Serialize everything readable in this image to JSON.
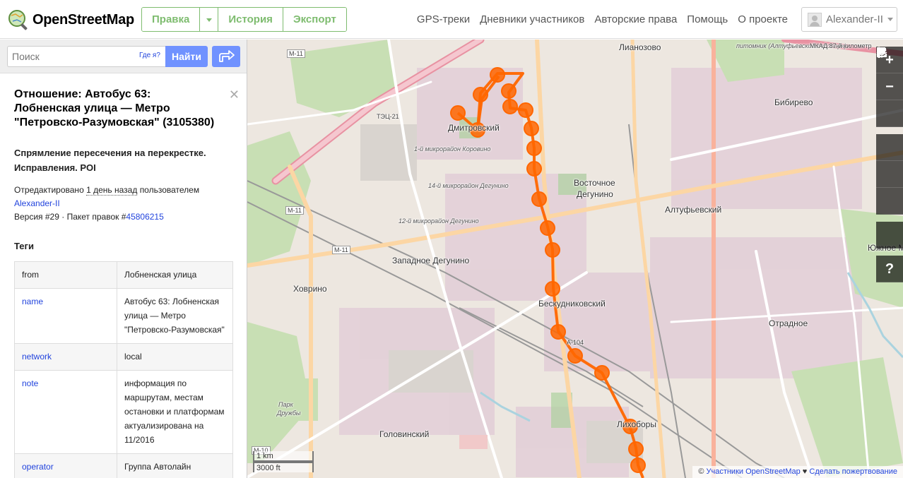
{
  "header": {
    "logo_text": "OpenStreetMap",
    "edit_label": "Правка",
    "history_label": "История",
    "export_label": "Экспорт",
    "nav": [
      "GPS-треки",
      "Дневники участников",
      "Авторские права",
      "Помощь",
      "О проекте"
    ],
    "user_name": "Alexander-II"
  },
  "search": {
    "placeholder": "Поиск",
    "where_label": "Где я?",
    "go_label": "Найти"
  },
  "sidebar": {
    "title": "Отношение: Автобус 63: Лобненская улица — Метро \"Петровско-Разумовская\" (3105380)",
    "comment": "Спрямление пересечения на перекрестке. Исправления. POI",
    "edited_prefix": "Отредактировано",
    "edited_ago": "1 день назад",
    "edited_by": "пользователем",
    "user": "Alexander-II",
    "version_prefix": "Версия #29 · Пакет правок #",
    "changeset": "45806215",
    "tags_title": "Теги",
    "tags": [
      {
        "key": "from",
        "value": "Лобненская улица",
        "link": false
      },
      {
        "key": "name",
        "value": "Автобус 63: Лобненская улица — Метро \"Петровско-Разумовская\"",
        "link": true
      },
      {
        "key": "network",
        "value": "local",
        "link": true
      },
      {
        "key": "note",
        "value": "информация по маршрутам, местам остановки и платформам актуализирована на 11/2016",
        "link": true
      },
      {
        "key": "operator",
        "value": "Группа Автолайн",
        "link": true
      }
    ]
  },
  "map": {
    "labels": {
      "dmitrovsky": "Дмитровский",
      "vostochnoe": "Восточное",
      "degunino": "Дегунино",
      "zapadnoe": "Западное Дегунино",
      "khovrino": "Ховрино",
      "beskudnikovsky": "Бескудниковский",
      "altufevsky": "Алтуфьевский",
      "bibirevo": "Бибирево",
      "lianozovo": "Лианозово",
      "otradnoe": "Отрадное",
      "golovinsky": "Головинский",
      "likhobory": "Лихоборы",
      "yuzhnoe": "Южное М",
      "park": "Парк",
      "druzhby": "Дружбы",
      "tets": "ТЭЦ-21",
      "m11": "М-11",
      "m10": "М-10",
      "a104": "А-104",
      "korovino": "1-й микрорайон Коровино",
      "mkr14": "14-й микрорайон Дегунино",
      "mkr12": "12-й микрорайон Дегунино",
      "pitomnik": "питомник (Алтуфьевский лесопарк)",
      "mkad": "МКАД 87-й километр"
    },
    "scale_km": "1 km",
    "scale_ft": "3000 ft",
    "attribution_prefix": "© ",
    "attribution_link": "Участники OpenStreetMap",
    "attribution_heart": " ♥ ",
    "attribution_donate": "Сделать пожертвование"
  },
  "colors": {
    "accent": "#7ebc6f",
    "search_button": "#7092ff",
    "route": "#ff6600",
    "link": "#2244dd"
  }
}
